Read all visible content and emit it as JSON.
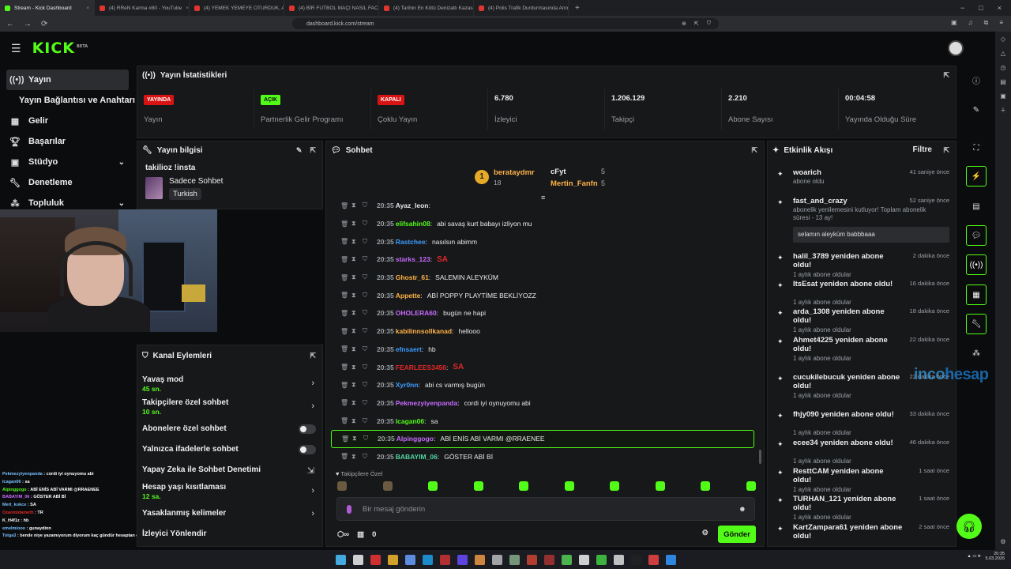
{
  "browser": {
    "tabs": [
      "Stream - Kick Dashboard",
      "(4) RReN Karma #80 - YouTube",
      "(4) YEMEK YEMEYE OTURDUK, AZAR",
      "(4) BİR FUTBOL MAÇI NASIL FACİAY",
      "(4) Tarihin En Kötü Denizaltı Kazası -",
      "(4) Polis Trafik Durdurmasında Annen"
    ],
    "url": "dashboard.kick.com/stream"
  },
  "header": {
    "logo": "KICK",
    "beta": "BETA"
  },
  "sidebar": {
    "items": [
      {
        "label": "Yayın",
        "icon": "broadcast-icon"
      },
      {
        "label": "Yayın Bağlantısı ve Anahtarı"
      },
      {
        "label": "Gelir",
        "icon": "revenue-icon"
      },
      {
        "label": "Başarılar",
        "icon": "trophy-icon"
      },
      {
        "label": "Stüdyo",
        "icon": "studio-icon"
      },
      {
        "label": "Denetleme",
        "icon": "wrench-icon"
      },
      {
        "label": "Topluluk",
        "icon": "community-icon"
      }
    ]
  },
  "stats": {
    "title": "Yayın İstatistikleri",
    "items": [
      {
        "badge": "YAYINDA",
        "label": "Yayın"
      },
      {
        "badge": "AÇIK",
        "label": "Partnerlik Gelir Programı"
      },
      {
        "badge": "KAPALI",
        "label": "Çoklu Yayın"
      },
      {
        "value": "6.780",
        "label": "İzleyici"
      },
      {
        "value": "1.206.129",
        "label": "Takipçi"
      },
      {
        "value": "2.210",
        "label": "Abone Sayısı"
      },
      {
        "value": "00:04:58",
        "label": "Yayında Olduğu Süre"
      }
    ]
  },
  "stream_info": {
    "title": "Yayın bilgisi",
    "stream_title": "takilioz !insta",
    "category": "Sadece Sohbet",
    "language": "Turkish"
  },
  "channel_actions": {
    "title": "Kanal Eylemleri",
    "items": [
      {
        "label": "Yavaş mod",
        "sub": "45 sn."
      },
      {
        "label": "Takipçilere özel sohbet",
        "sub": "10 sn."
      },
      {
        "label": "Abonelere özel sohbet"
      },
      {
        "label": "Yalnızca ifadelerle sohbet"
      },
      {
        "label": "Yapay Zeka ile Sohbet Denetimi"
      },
      {
        "label": "Hesap yaşı kısıtlaması",
        "sub": "12 sa."
      },
      {
        "label": "Yasaklanmış kelimeler"
      },
      {
        "label": "İzleyici Yönlendir"
      }
    ]
  },
  "overlay_chat": [
    {
      "u": "Pekmezyiyenpanda",
      "m": "cordi iyi oynuyomu abi"
    },
    {
      "u": "Icagan06",
      "m": "sa"
    },
    {
      "u": "Alpinggogo",
      "m": "ABİ ENİS ABİ VARMI @RRAENEE"
    },
    {
      "u": "BABAYIM_06",
      "m": "GÖSTER ABİ Bİ"
    },
    {
      "u": "Mert_kokce",
      "m": "SA"
    },
    {
      "u": "Ozanmidameth",
      "m": "TR"
    },
    {
      "u": "K_H4f1z",
      "m": "hb"
    },
    {
      "u": "emelmiooo",
      "m": "gunaydinn"
    },
    {
      "u": "Tolga3",
      "m": "bende niye yazamıyorum diyorum kaç gündür hesaptan çıkmışım"
    }
  ],
  "chat": {
    "title": "Sohbet",
    "pinned": {
      "rank": "1",
      "user1": "berataydmr",
      "count1": "18",
      "user2": "cFyt",
      "count2": "5",
      "user3": "Mertin_Fanfn",
      "count3": "5"
    },
    "messages": [
      {
        "time": "20:35",
        "user": "Ayaz_leon",
        "msg": "",
        "color": "#e8e8e8"
      },
      {
        "time": "20:35",
        "user": "elifsahin08",
        "msg": "abi savaş kurt babayı izliyon mu",
        "color": "#53fc18"
      },
      {
        "time": "20:35",
        "user": "Rastchee",
        "msg": "nasılsın abimm",
        "color": "#3e9cff"
      },
      {
        "time": "20:35",
        "user": "starks_123",
        "msg": "SA",
        "color": "#c86bff",
        "sa": true
      },
      {
        "time": "20:35",
        "user": "Ghostr_61",
        "msg": "SALEMIN ALEYKÜM",
        "color": "#ffb347"
      },
      {
        "time": "20:35",
        "user": "Appette",
        "msg": "ABİ POPPY PLAYTİME BEKLİYOZZ",
        "color": "#ffb347"
      },
      {
        "time": "20:35",
        "user": "OHOLERA60",
        "msg": "bugün ne hapi",
        "color": "#c86bff"
      },
      {
        "time": "20:35",
        "user": "kabilinnsollkanad",
        "msg": "hellooo",
        "color": "#ffb347"
      },
      {
        "time": "20:35",
        "user": "efnsaert",
        "msg": "hb",
        "color": "#3e9cff"
      },
      {
        "time": "20:35",
        "user": "FEARLEES3456",
        "msg": "SA",
        "color": "#e12828",
        "sa": true
      },
      {
        "time": "20:35",
        "user": "Xyr0nn",
        "msg": "abi cs varmış bugün",
        "color": "#3e9cff"
      },
      {
        "time": "20:35",
        "user": "Pekmezyiyenpanda",
        "msg": "cordi iyi oynuyomu abi",
        "color": "#c86bff"
      },
      {
        "time": "20:35",
        "user": "Icagan06",
        "msg": "sa",
        "color": "#53fc18"
      },
      {
        "time": "20:35",
        "user": "Alpinggogo",
        "msg": "ABİ ENİS ABİ VARMI @RRAENEE",
        "color": "#c86bff",
        "hl": true
      },
      {
        "time": "20:35",
        "user": "BABAYIM_06",
        "msg": "GÖSTER ABİ Bİ",
        "color": "#53d6a0"
      }
    ],
    "followers_only": "Takipçilere Özel",
    "placeholder": "Bir mesaj gönderin",
    "points": "0",
    "send": "Gönder"
  },
  "activity": {
    "title": "Etkinlik Akışı",
    "filter": "Filtre",
    "events": [
      {
        "name": "woarich",
        "sub": "abone oldu",
        "time": "41 saniye önce"
      },
      {
        "name": "fast_and_crazy",
        "sub": "abonelik yenilemesini kutluyor! Toplam abonelik süresi - 13 ay!",
        "msg": "selamın aleyküm babbbaaa",
        "time": "52 saniye önce"
      },
      {
        "name": "halil_3789 yeniden abone oldu!",
        "sub": "1 aylık abone oldular",
        "time": "2 dakika önce"
      },
      {
        "name": "ItsEsat yeniden abone oldu!",
        "sub": "1 aylık abone oldular",
        "time": "16 dakika önce"
      },
      {
        "name": "arda_1308 yeniden abone oldu!",
        "sub": "1 aylık abone oldular",
        "time": "18 dakika önce"
      },
      {
        "name": "Ahmet4225 yeniden abone oldu!",
        "sub": "1 aylık abone oldular",
        "time": "22 dakika önce"
      },
      {
        "name": "cucukilebucuk yeniden abone oldu!",
        "sub": "1 aylık abone oldular",
        "time": "22 dakika önce"
      },
      {
        "name": "fhjy090 yeniden abone oldu!",
        "sub": "1 aylık abone oldular",
        "time": "33 dakika önce"
      },
      {
        "name": "ecee34 yeniden abone oldu!",
        "sub": "1 aylık abone oldular",
        "time": "46 dakika önce"
      },
      {
        "name": "ResttCAM yeniden abone oldu!",
        "sub": "1 aylık abone oldular",
        "time": "1 saat önce"
      },
      {
        "name": "TURHAN_121 yeniden abone oldu!",
        "sub": "1 aylık abone oldular",
        "time": "1 saat önce"
      },
      {
        "name": "KartZampara61 yeniden abone oldu!",
        "sub": "",
        "time": "2 saat önce"
      }
    ]
  },
  "watermark": {
    "a": "inco",
    "b": "hesap",
    ".com": ".com"
  },
  "tray": {
    "time": "20:35",
    "date": "5.03.2026"
  }
}
